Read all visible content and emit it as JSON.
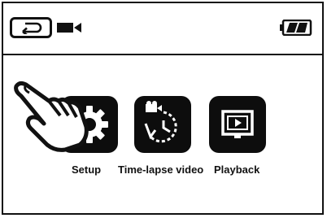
{
  "menu": {
    "items": [
      {
        "label": "Setup",
        "icon": "gear-icon"
      },
      {
        "label": "Time-lapse video",
        "icon": "timelapse-icon"
      },
      {
        "label": "Playback",
        "icon": "playback-icon"
      }
    ]
  },
  "status": {
    "mode_icon": "video-camera-icon",
    "battery_icon": "battery-icon"
  },
  "colors": {
    "tile": "#0d0d0d",
    "border": "#111111",
    "background": "#ffffff"
  }
}
